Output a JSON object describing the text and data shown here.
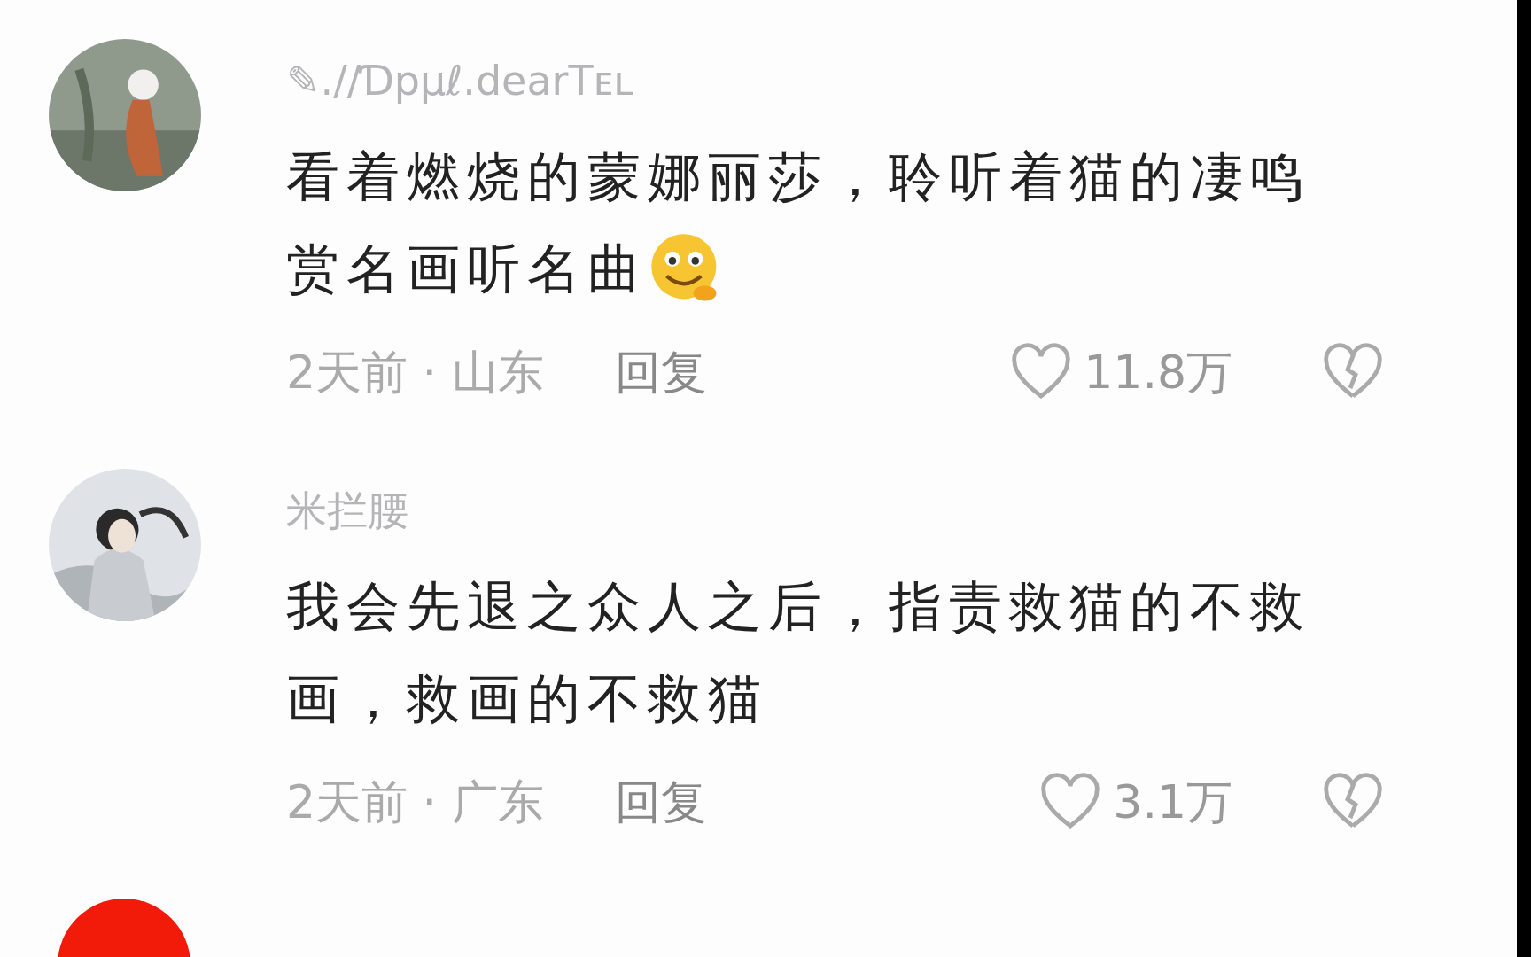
{
  "comments": [
    {
      "kind": "comment",
      "username": "✎.//Ɗpμℓ.dearTᴇʟ",
      "lines": [
        "看着燃烧的蒙娜丽莎，聆听着猫的凄鸣",
        "赏名画听名曲"
      ],
      "emoji": true,
      "time": "2天前 · 山东",
      "reply": "回复",
      "likes": "11.8万"
    },
    {
      "kind": "comment",
      "username": "米拦腰",
      "lines": [
        "我会先退之众人之后，指责救猫的不救",
        "画，救画的不救猫"
      ],
      "emoji": false,
      "time": "2天前 · 广东",
      "reply": "回复",
      "likes": "3.1万"
    },
    {
      "kind": "cut_off"
    }
  ]
}
